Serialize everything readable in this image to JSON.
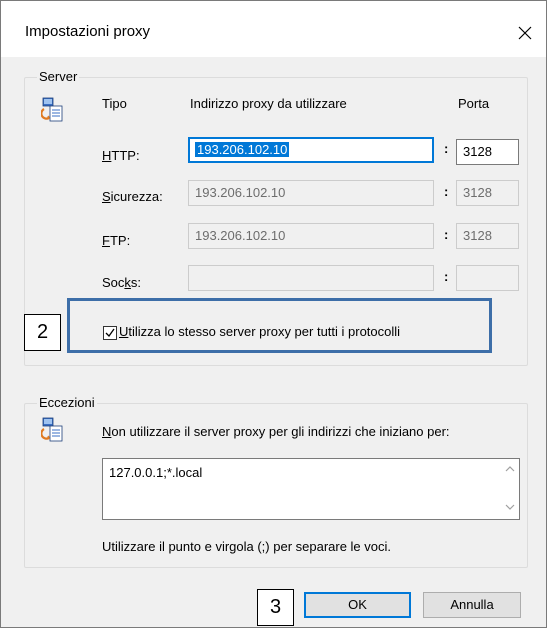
{
  "window": {
    "title": "Impostazioni proxy",
    "close_icon": "close-icon"
  },
  "server": {
    "legend": "Server",
    "headers": {
      "type": "Tipo",
      "address": "Indirizzo proxy da utilizzare",
      "port": "Porta"
    },
    "rows": [
      {
        "label": "HTTP:",
        "key": "H",
        "rest": "TTP:",
        "address": "193.206.102.10",
        "port": "3128",
        "enabled": true
      },
      {
        "label": "Sicurezza:",
        "key": "S",
        "rest": "icurezza:",
        "address": "193.206.102.10",
        "port": "3128",
        "enabled": false
      },
      {
        "label": "FTP:",
        "key": "F",
        "rest": "TP:",
        "address": "193.206.102.10",
        "port": "3128",
        "enabled": false
      },
      {
        "label": "Socks:",
        "pre": "Soc",
        "key": "k",
        "rest": "s:",
        "address": "",
        "port": "",
        "enabled": false
      }
    ],
    "colon": ":",
    "same_proxy": {
      "key": "U",
      "rest": "tilizza lo stesso server proxy per tutti i protocolli",
      "checked": true
    }
  },
  "exceptions": {
    "legend": "Eccezioni",
    "desc_key": "N",
    "desc_rest": "on utilizzare il server proxy per gli indirizzi che iniziano per:",
    "value": "127.0.0.1;*.local",
    "hint": "Utilizzare il punto e virgola (;) per separare le voci."
  },
  "buttons": {
    "ok": "OK",
    "cancel": "Annulla"
  },
  "annotations": {
    "step2": "2",
    "step3": "3"
  },
  "colors": {
    "accent": "#0078d7",
    "highlight_border": "#3d6ea8"
  }
}
